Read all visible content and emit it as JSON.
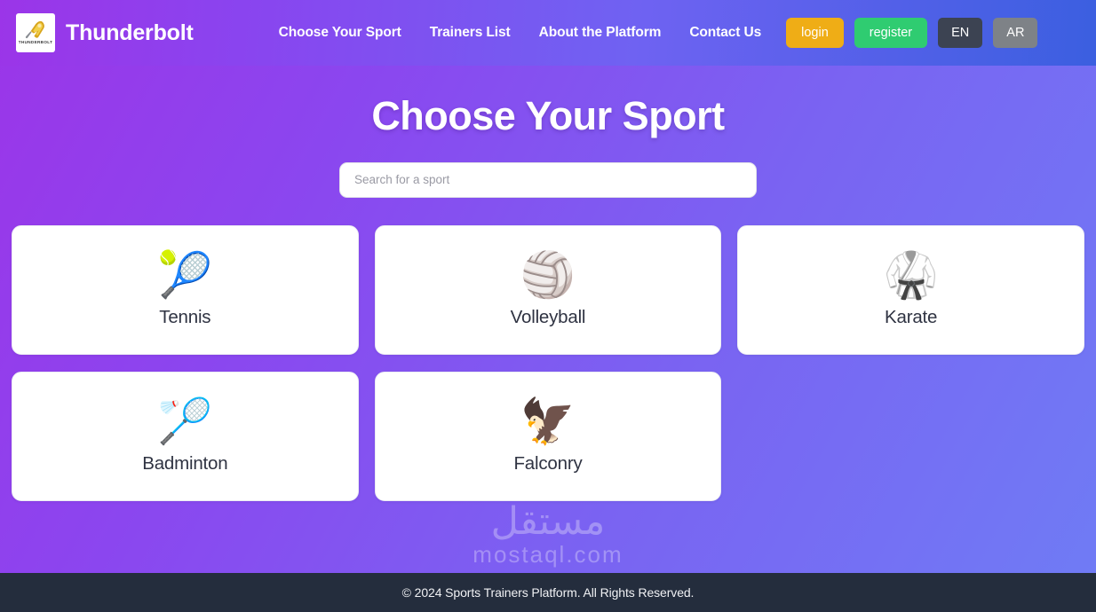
{
  "brand": {
    "name": "Thunderbolt",
    "logo_word": "THUNDERBOLT",
    "logo_icon": "lightning-bolt-icon"
  },
  "nav": {
    "links": [
      {
        "label": "Choose Your Sport",
        "name": "nav-link-choose-your-sport"
      },
      {
        "label": "Trainers List",
        "name": "nav-link-trainers-list"
      },
      {
        "label": "About the Platform",
        "name": "nav-link-about-the-platform"
      },
      {
        "label": "Contact Us",
        "name": "nav-link-contact-us"
      }
    ],
    "login_label": "login",
    "register_label": "register",
    "lang_en": "EN",
    "lang_ar": "AR"
  },
  "hero": {
    "title": "Choose Your Sport"
  },
  "search": {
    "value": "",
    "placeholder": "Search for a sport"
  },
  "sports": [
    {
      "label": "Tennis",
      "icon": "tennis-racquet-icon",
      "emoji": "🎾"
    },
    {
      "label": "Volleyball",
      "icon": "volleyball-icon",
      "emoji": "🏐"
    },
    {
      "label": "Karate",
      "icon": "martial-arts-gi-icon",
      "emoji": "🥋"
    },
    {
      "label": "Badminton",
      "icon": "badminton-racquet-icon",
      "emoji": "🏸"
    },
    {
      "label": "Falconry",
      "icon": "falcon-icon",
      "emoji": "🦅"
    }
  ],
  "watermark": {
    "arabic": "مستقل",
    "latin": "mostaql.com"
  },
  "footer": {
    "text": "© 2024 Sports Trainers Platform. All Rights Reserved."
  },
  "colors": {
    "login_button": "#efad16",
    "register_button": "#2fcc71",
    "lang_active": "#3c4352",
    "lang_inactive": "#7e8287",
    "footer_bg": "#242d3d",
    "gradient_start": "#9b35e8",
    "gradient_end": "#3b5fe0",
    "card_label": "#2f3342"
  }
}
